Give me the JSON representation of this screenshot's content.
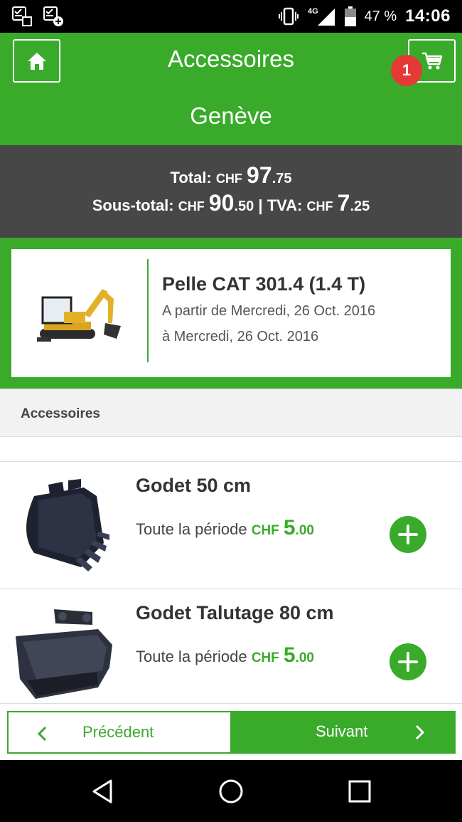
{
  "status_bar": {
    "network": "4G",
    "battery_pct": "47 %",
    "time": "14:06"
  },
  "header": {
    "title": "Accessoires",
    "city": "Genève",
    "cart_count": "1"
  },
  "totals": {
    "total_label": "Total:",
    "currency": "CHF",
    "total_int": "97",
    "total_dec": ".75",
    "subtotal_label": "Sous-total:",
    "subtotal_int": "90",
    "subtotal_dec": ".50",
    "separator": "|",
    "tva_label": "TVA:",
    "tva_int": "7",
    "tva_dec": ".25"
  },
  "machine": {
    "name": "Pelle CAT 301.4 (1.4 T)",
    "from": "A partir de Mercredi, 26 Oct. 2016",
    "to": "à Mercredi, 26 Oct. 2016"
  },
  "section": {
    "title": "Accessoires"
  },
  "items": [
    {
      "name": "Godet 50 cm",
      "period": "Toute la période",
      "currency": "CHF",
      "price_int": "5",
      "price_dec": ".00"
    },
    {
      "name": "Godet Talutage 80 cm",
      "period": "Toute la période",
      "currency": "CHF",
      "price_int": "5",
      "price_dec": ".00"
    }
  ],
  "nav": {
    "prev_label": "Précédent",
    "next_label": "Suivant"
  },
  "colors": {
    "accent": "#3aaa2b",
    "badge": "#e53935",
    "totals_bg": "#474747"
  },
  "icons": [
    "home-icon",
    "cart-icon",
    "plus-icon",
    "chevron-left-icon",
    "chevron-right-icon",
    "back-icon",
    "home-circle-icon",
    "recents-icon"
  ]
}
